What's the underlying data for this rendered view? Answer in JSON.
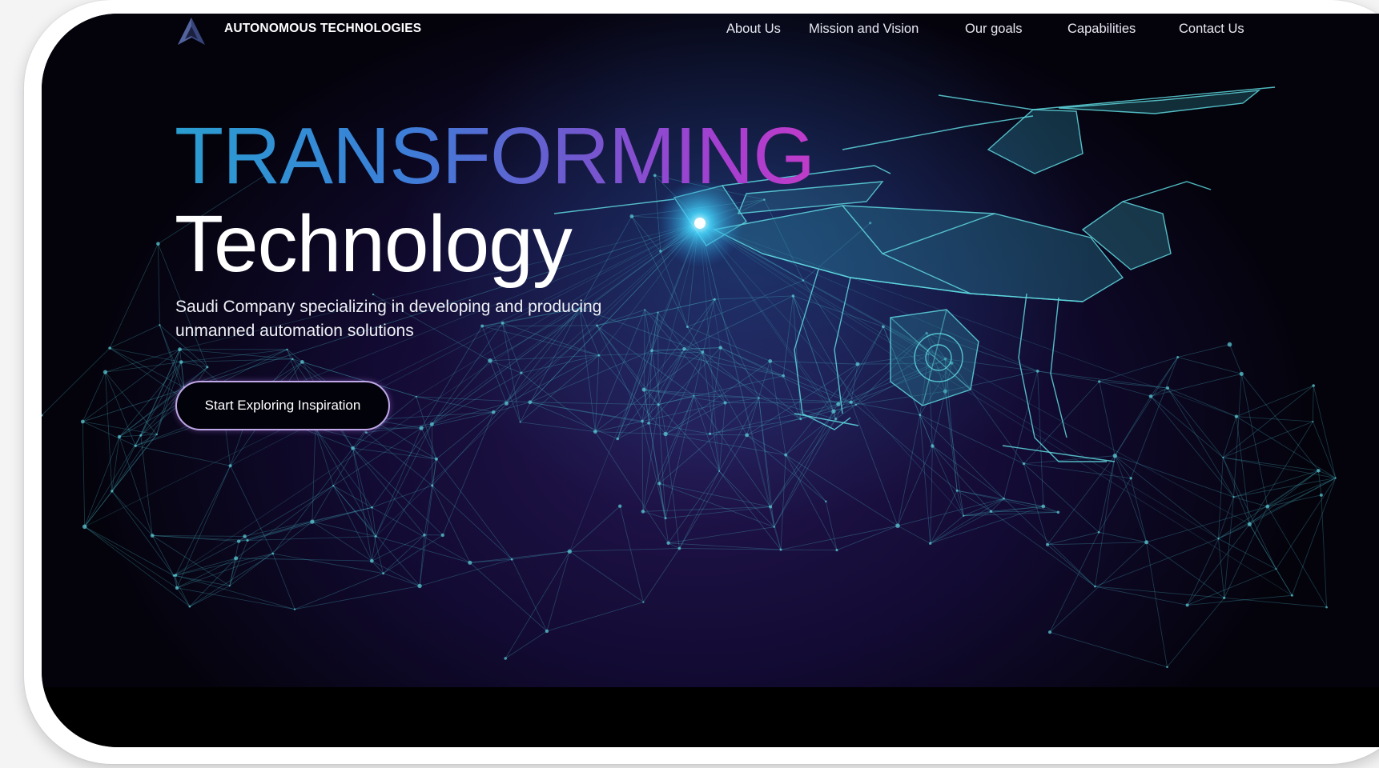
{
  "nav": {
    "brand": "AUTONOMOUS TECHNOLOGIES",
    "logo_icon": "triangle-logo-icon",
    "items": [
      {
        "label": "About Us"
      },
      {
        "label": "Mission and Vision"
      },
      {
        "label": "Our goals"
      },
      {
        "label": "Capabilities"
      },
      {
        "label": "Contact Us"
      }
    ]
  },
  "hero": {
    "headline_top": "TRANSFORMING",
    "headline_bottom": "Technology",
    "subtitle_line1": "Saudi Company specializing in developing and producing",
    "subtitle_line2": "unmanned automation solutions",
    "cta_label": "Start Exploring Inspiration",
    "illustration": "wireframe-drone-image"
  },
  "colors": {
    "gradient_start": "#2a9ed0",
    "gradient_end": "#c13bc9",
    "background": "#130b34",
    "mesh": "#4fd2d8"
  }
}
